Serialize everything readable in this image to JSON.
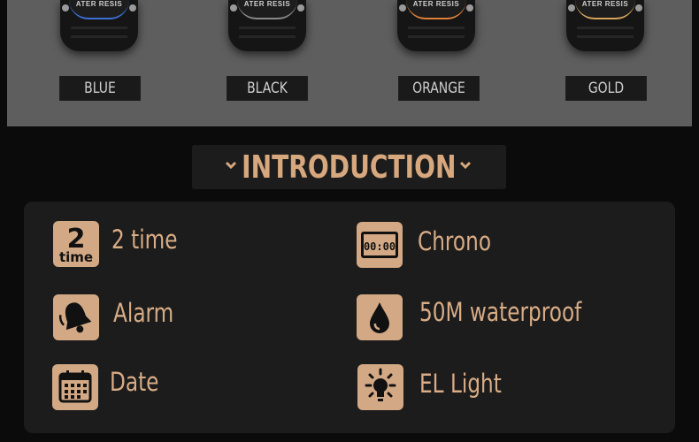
{
  "watches": [
    {
      "engraving": "ATER RESIS",
      "label": "BLUE",
      "accent": "#3d6fd6"
    },
    {
      "engraving": "ATER RESIS",
      "label": "BLACK",
      "accent": "#cfcfcf"
    },
    {
      "engraving": "ATER RESIS",
      "label": "ORANGE",
      "accent": "#e0803a"
    },
    {
      "engraving": "ATER RESIS",
      "label": "GOLD",
      "accent": "#d6a35c"
    }
  ],
  "intro": {
    "title": "INTRODUCTION",
    "icons": [
      "chevron-down-icon",
      "chevron-down-icon"
    ]
  },
  "features": [
    {
      "icon": "two-time-icon",
      "icon_text_top": "2",
      "icon_text_bottom": "time",
      "label": "2 time"
    },
    {
      "icon": "chrono-icon",
      "icon_text": "00:00",
      "label": "Chrono"
    },
    {
      "icon": "alarm-bell-icon",
      "label": "Alarm"
    },
    {
      "icon": "water-drop-icon",
      "label": "50M waterproof"
    },
    {
      "icon": "calendar-icon",
      "label": "Date"
    },
    {
      "icon": "light-bulb-icon",
      "label": "EL Light"
    }
  ],
  "colors": {
    "accent": "#d7a77e",
    "icon_bg": "#d3a985",
    "panel": "#1c1c1c",
    "background": "#0b0b0b",
    "band": "#5e5e5e"
  }
}
